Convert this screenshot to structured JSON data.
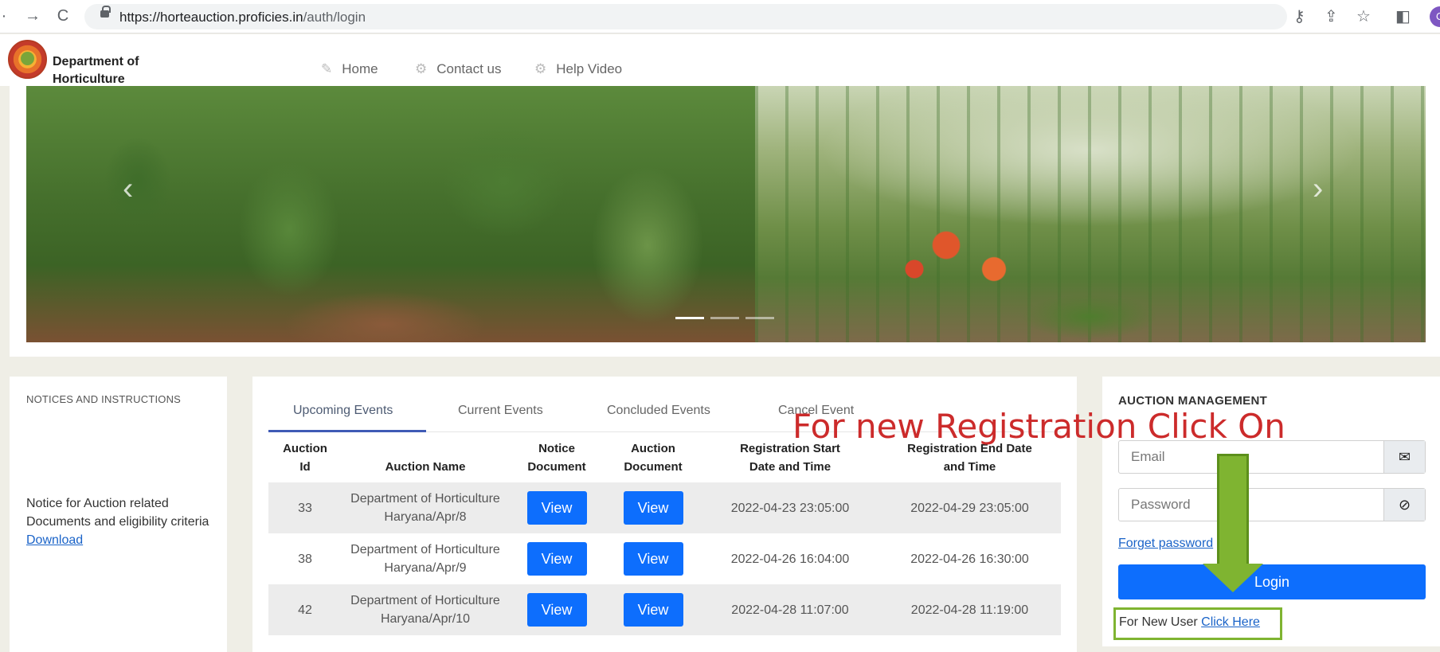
{
  "browser": {
    "url_domain": "https://horteauction.proficies.in",
    "url_path": "/auth/login",
    "profile_initial": "O",
    "icons": [
      "back-icon",
      "forward-icon",
      "reload-icon",
      "lock-icon",
      "key-icon",
      "share-icon",
      "star-icon",
      "sidepanel-icon"
    ]
  },
  "header": {
    "brand_line1": "Department of",
    "brand_line2": "Horticulture",
    "nav": [
      {
        "label": "Home",
        "icon": "edit-icon"
      },
      {
        "label": "Contact us",
        "icon": "gear-icon"
      },
      {
        "label": "Help Video",
        "icon": "gear-icon"
      }
    ]
  },
  "carousel": {
    "prev_glyph": "‹",
    "next_glyph": "›",
    "slide_count": 3,
    "active_index": 0
  },
  "notices": {
    "title": "NOTICES AND INSTRUCTIONS",
    "text": "Notice for Auction related Documents and eligibility criteria",
    "link": "Download"
  },
  "events": {
    "tabs": [
      "Upcoming Events",
      "Current Events",
      "Concluded Events",
      "Cancel Event"
    ],
    "active_tab": 0,
    "columns": [
      {
        "line1": "Auction",
        "line2": "Id"
      },
      {
        "line1": "",
        "line2": "Auction Name"
      },
      {
        "line1": "Notice",
        "line2": "Document"
      },
      {
        "line1": "Auction",
        "line2": "Document"
      },
      {
        "line1": "Registration Start",
        "line2": "Date and Time"
      },
      {
        "line1": "Registration End Date",
        "line2": "and Time"
      }
    ],
    "view_label": "View",
    "rows": [
      {
        "id": "33",
        "name1": "Department of Horticulture",
        "name2": "Haryana/Apr/8",
        "start": "2022-04-23 23:05:00",
        "end": "2022-04-29 23:05:00"
      },
      {
        "id": "38",
        "name1": "Department of Horticulture",
        "name2": "Haryana/Apr/9",
        "start": "2022-04-26 16:04:00",
        "end": "2022-04-26 16:30:00"
      },
      {
        "id": "42",
        "name1": "Department of Horticulture",
        "name2": "Haryana/Apr/10",
        "start": "2022-04-28 11:07:00",
        "end": "2022-04-28 11:19:00"
      }
    ]
  },
  "auction": {
    "title": "AUCTION MANAGEMENT",
    "email_placeholder": "Email",
    "password_placeholder": "Password",
    "forget_label": "Forget password",
    "login_label": "Login",
    "new_user_text": "For New User",
    "new_user_link": "Click Here"
  },
  "annotation": {
    "text": "For new Registration Click On",
    "color": "#cc2b2b",
    "arrow_color": "#7fb431"
  }
}
